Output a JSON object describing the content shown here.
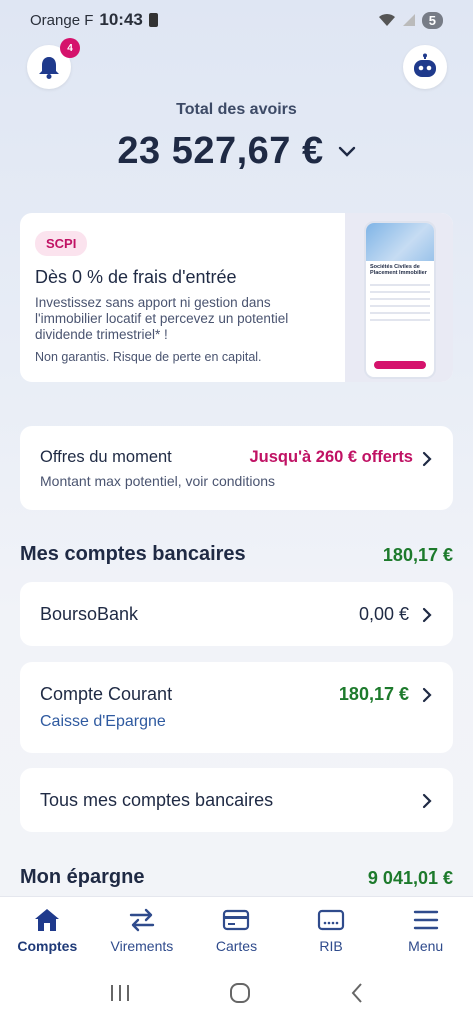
{
  "status_bar": {
    "carrier": "Orange F",
    "time": "10:43",
    "battery": "5"
  },
  "notifications": {
    "count": "4"
  },
  "total": {
    "label": "Total des avoirs",
    "amount": "23 527,67 €"
  },
  "promo": {
    "badge": "SCPI",
    "title": "Dès 0 % de frais d'entrée",
    "description": "Investissez sans apport ni gestion dans l'immobilier locatif et percevez un potentiel dividende trimestriel* !",
    "warning": "Non garantis. Risque de perte en capital.",
    "phone_title": "Sociétés Civiles de Placement Immobilier"
  },
  "offers": {
    "title": "Offres du moment",
    "promo": "Jusqu'à 260 € offerts",
    "subtitle": "Montant max potentiel, voir conditions"
  },
  "bank_accounts": {
    "title": "Mes comptes bancaires",
    "total": "180,17 €",
    "items": [
      {
        "name": "BoursoBank",
        "amount": "0,00 €"
      },
      {
        "name": "Compte Courant",
        "amount": "180,17 €",
        "subtitle": "Caisse d'Epargne"
      }
    ],
    "all_label": "Tous mes comptes bancaires"
  },
  "savings": {
    "title": "Mon épargne",
    "total": "9 041,01 €"
  },
  "bottom_nav": [
    {
      "label": "Comptes",
      "icon": "home-icon",
      "active": true
    },
    {
      "label": "Virements",
      "icon": "transfer-icon"
    },
    {
      "label": "Cartes",
      "icon": "card-icon"
    },
    {
      "label": "RIB",
      "icon": "rib-icon"
    },
    {
      "label": "Menu",
      "icon": "menu-icon"
    }
  ],
  "colors": {
    "accent_pink": "#c01264",
    "positive_green": "#1d7a2c",
    "navy": "#1f2a44",
    "nav_blue": "#2f4b8c"
  }
}
